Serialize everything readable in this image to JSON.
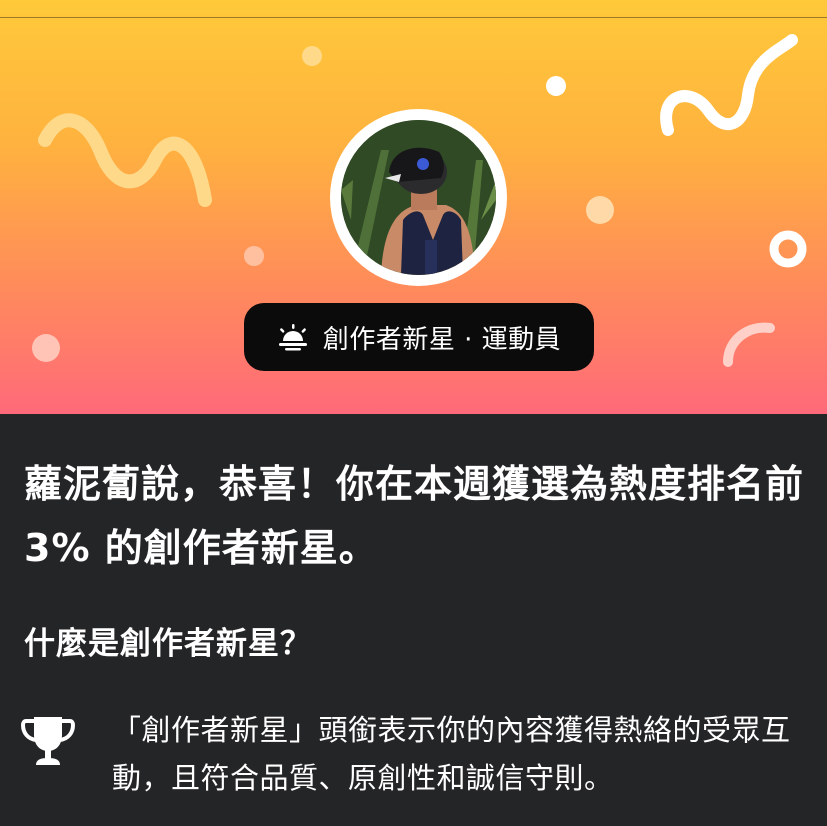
{
  "banner": {
    "badge_text": "創作者新星 · 運動員",
    "badge_icon": "sunrise-icon",
    "colors": {
      "gradient_top": "#ffc93a",
      "gradient_bottom": "#ff6a7a",
      "badge_bg": "#0b0b0c"
    }
  },
  "content": {
    "headline": "蘿泥蔔說，恭喜！你在本週獲選為熱度排名前 3% 的創作者新星。",
    "section_title": "什麼是創作者新星？",
    "info": {
      "icon": "trophy-icon",
      "text": "「創作者新星」頭銜表示你的內容獲得熱絡的受眾互動，且符合品質、原創性和誠信守則。"
    }
  },
  "colors": {
    "background": "#242527",
    "text": "#ffffff"
  }
}
